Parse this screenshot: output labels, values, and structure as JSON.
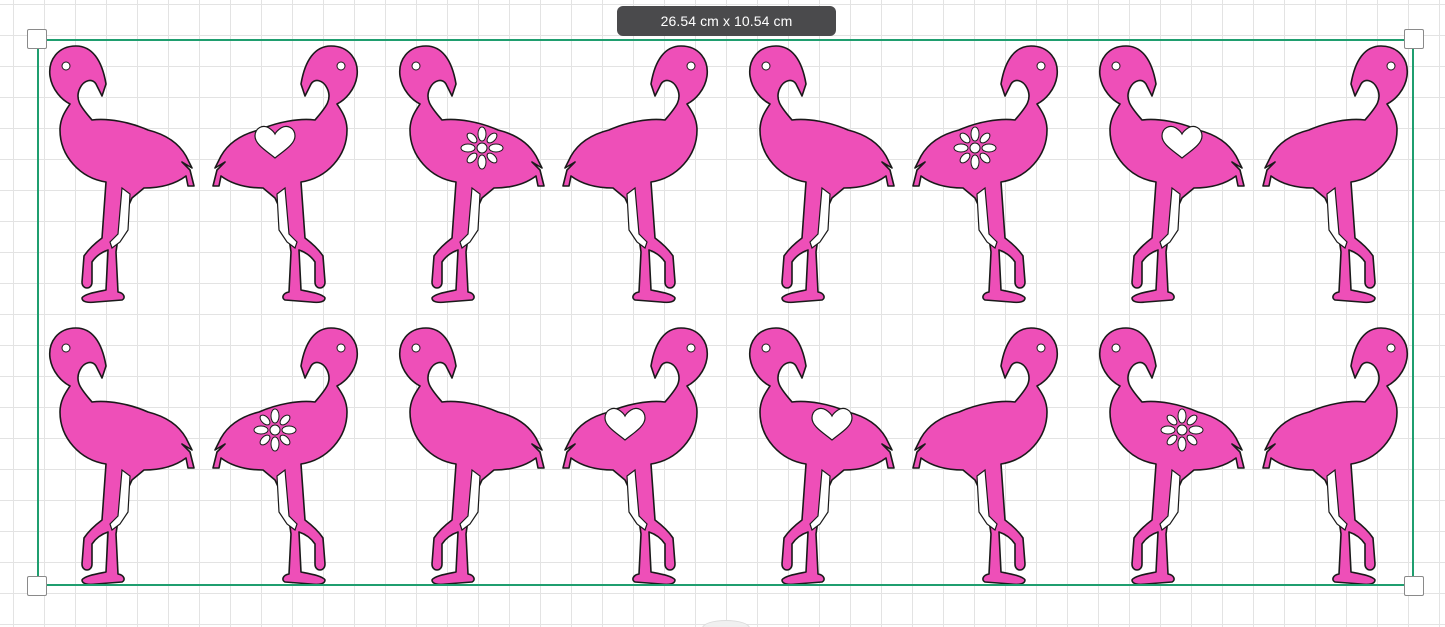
{
  "canvas": {
    "size_label": "26.54 cm x 10.54 cm",
    "grid_color": "#e3e3e3",
    "selection_color": "#1f9e6f"
  },
  "design": {
    "fill_color": "#ee4fb8",
    "outline_color": "#1a1a1a",
    "rows": [
      [
        "plain",
        "heart",
        "flower",
        "plain",
        "plain",
        "flower",
        "heart",
        "plain"
      ],
      [
        "plain",
        "flower",
        "plain",
        "heart",
        "heart",
        "plain",
        "flower",
        "plain"
      ]
    ],
    "facing": [
      [
        "right",
        "left",
        "right",
        "left",
        "right",
        "left",
        "right",
        "left"
      ],
      [
        "right",
        "left",
        "right",
        "left",
        "right",
        "left",
        "right",
        "left"
      ]
    ]
  }
}
